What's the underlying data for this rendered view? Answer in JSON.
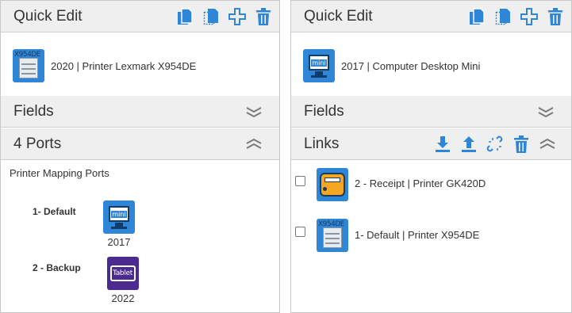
{
  "left": {
    "quick_edit": {
      "title": "Quick Edit",
      "icons": [
        "copy-icon",
        "duplicate-icon",
        "add-icon",
        "trash-icon"
      ]
    },
    "device": {
      "label": "2020 | Printer Lexmark X954DE",
      "icon": "printer-icon",
      "icon_text": "X954DE"
    },
    "fields": {
      "title": "Fields",
      "icon": "expand-chevrons-icon"
    },
    "ports": {
      "title": "4 Ports",
      "icon": "collapse-chevrons-icon",
      "section_label": "Printer Mapping Ports",
      "items": [
        {
          "name": "1- Default",
          "year": "2017",
          "icon": "monitor-icon",
          "icon_text": "mini",
          "color": "#2f86d6"
        },
        {
          "name": "2 - Backup",
          "year": "2022",
          "icon": "tablet-icon",
          "icon_text": "Tablet",
          "color": "#4b2b8f"
        }
      ]
    }
  },
  "right": {
    "quick_edit": {
      "title": "Quick Edit",
      "icons": [
        "copy-icon",
        "duplicate-icon",
        "add-icon",
        "trash-icon"
      ]
    },
    "device": {
      "label": "2017 | Computer Desktop Mini",
      "icon": "monitor-icon",
      "icon_text": "mini"
    },
    "fields": {
      "title": "Fields",
      "icon": "expand-chevrons-icon"
    },
    "links": {
      "title": "Links",
      "icons": [
        "download-icon",
        "upload-icon",
        "unlink-icon",
        "trash-icon",
        "collapse-chevrons-icon"
      ],
      "items": [
        {
          "label": "2 - Receipt | Printer GK420D",
          "icon": "receipt-printer-icon",
          "accent": "#f5a623"
        },
        {
          "label": "1- Default | Printer X954DE",
          "icon": "printer-icon",
          "icon_text": "X954DE"
        }
      ]
    }
  },
  "colors": {
    "accent": "#2f86d6",
    "header_bg": "#efefef",
    "border": "#c8c8c8",
    "chevron": "#7a7a7a",
    "tablet": "#4b2b8f"
  }
}
